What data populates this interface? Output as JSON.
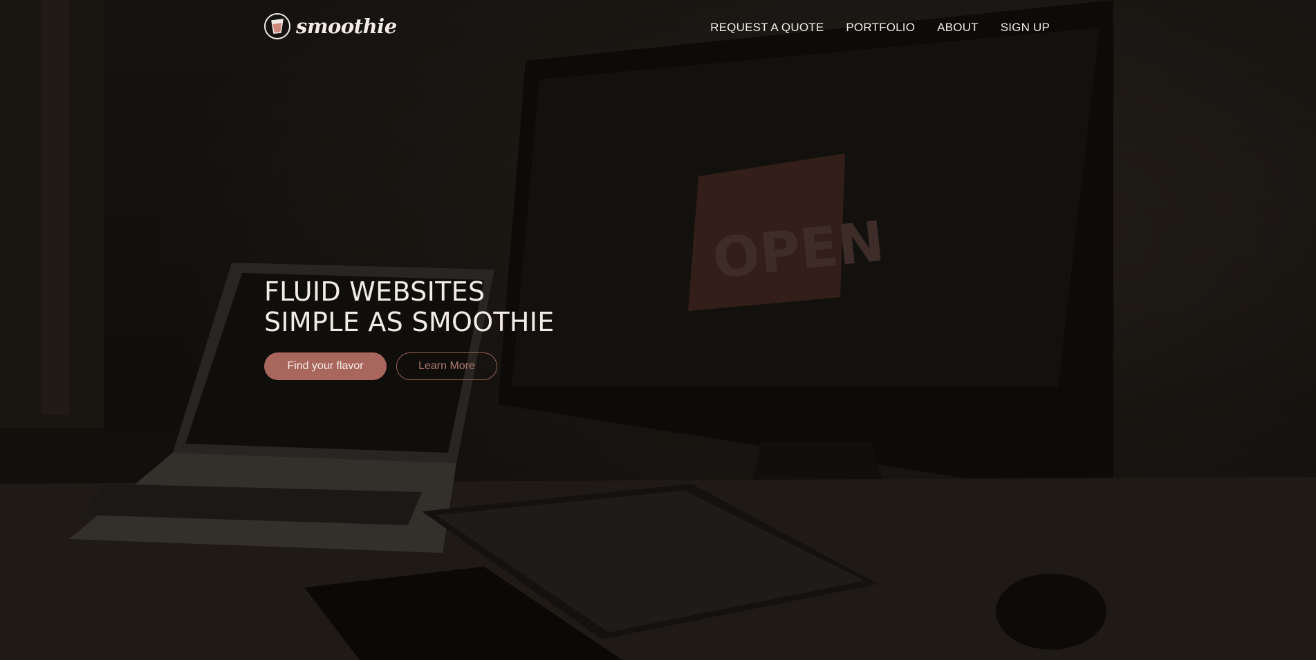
{
  "brand": {
    "name": "smoothie",
    "accent": "#a9665c"
  },
  "nav": {
    "items": [
      {
        "label": "REQUEST A QUOTE"
      },
      {
        "label": "PORTFOLIO"
      },
      {
        "label": "ABOUT"
      },
      {
        "label": "SIGN UP"
      }
    ]
  },
  "hero": {
    "title_line1": "FLUID WEBSITES",
    "title_line2": "SIMPLE AS SMOOTHIE",
    "primary_button": "Find your flavor",
    "secondary_button": "Learn More",
    "background_image": "desk-with-laptop-and-monitor-photo"
  }
}
